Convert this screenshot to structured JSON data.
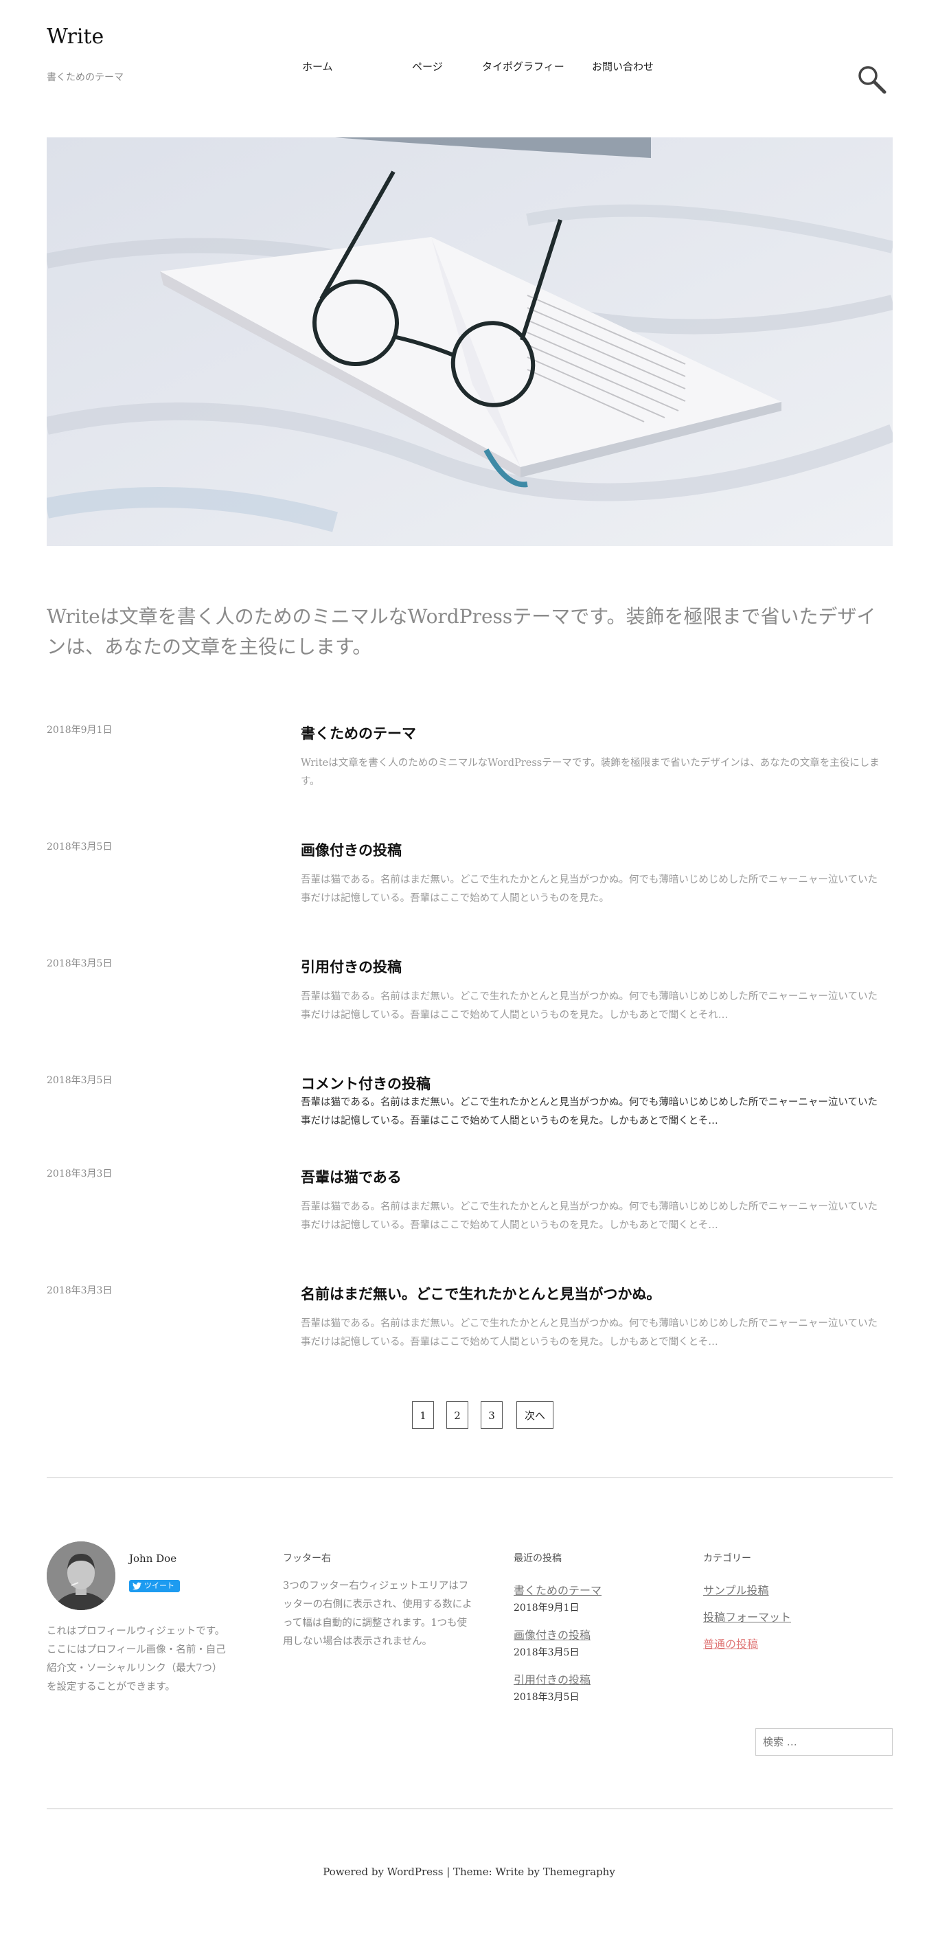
{
  "header": {
    "site_title": "Write",
    "site_description": "書くためのテーマ",
    "nav": [
      "ホーム",
      "ページ",
      "タイポグラフィー",
      "お問い合わせ"
    ]
  },
  "intro": "Writeは文章を書く人のためのミニマルなWordPressテーマです。装飾を極限まで省いたデザインは、あなたの文章を主役にします。",
  "posts": [
    {
      "date": "2018年9月1日",
      "title": "書くためのテーマ",
      "excerpt": "Writeは文章を書く人のためのミニマルなWordPressテーマです。装飾を極限まで省いたデザインは、あなたの文章を主役にします。"
    },
    {
      "date": "2018年3月5日",
      "title": "画像付きの投稿",
      "excerpt": "吾輩は猫である。名前はまだ無い。どこで生れたかとんと見当がつかぬ。何でも薄暗いじめじめした所でニャーニャー泣いていた事だけは記憶している。吾輩はここで始めて人間というものを見た。"
    },
    {
      "date": "2018年3月5日",
      "title": "引用付きの投稿",
      "excerpt": "吾輩は猫である。名前はまだ無い。どこで生れたかとんと見当がつかぬ。何でも薄暗いじめじめした所でニャーニャー泣いていた事だけは記憶している。吾輩はここで始めて人間というものを見た。しかもあとで聞くとそれ…"
    },
    {
      "date": "2018年3月5日",
      "title": "コメント付きの投稿",
      "excerpt": "吾輩は猫である。名前はまだ無い。どこで生れたかとんと見当がつかぬ。何でも薄暗いじめじめした所でニャーニャー泣いていた事だけは記憶している。吾輩はここで始めて人間というものを見た。しかもあとで聞くとそ…"
    },
    {
      "date": "2018年3月3日",
      "title": "吾輩は猫である",
      "excerpt": "吾輩は猫である。名前はまだ無い。どこで生れたかとんと見当がつかぬ。何でも薄暗いじめじめした所でニャーニャー泣いていた事だけは記憶している。吾輩はここで始めて人間というものを見た。しかもあとで聞くとそ…"
    },
    {
      "date": "2018年3月3日",
      "title": "名前はまだ無い。どこで生れたかとんと見当がつかぬ。",
      "excerpt": "吾輩は猫である。名前はまだ無い。どこで生れたかとんと見当がつかぬ。何でも薄暗いじめじめした所でニャーニャー泣いていた事だけは記憶している。吾輩はここで始めて人間というものを見た。しかもあとで聞くとそ…"
    }
  ],
  "pagination": [
    "1",
    "2",
    "3",
    "次へ"
  ],
  "footer": {
    "profile": {
      "name": "John Doe",
      "tweet_label": "ツイート",
      "text": "これはプロフィールウィジェットです。ここにはプロフィール画像・名前・自己紹介文・ソーシャルリンク（最大7つ）を設定することができます。"
    },
    "right": {
      "heading": "フッター右",
      "text": "3つのフッター右ウィジェットエリアはフッターの右側に表示され、使用する数によって幅は自動的に調整されます。1つも使用しない場合は表示されません。"
    },
    "recent": {
      "heading": "最近の投稿",
      "items": [
        {
          "title": "書くためのテーマ",
          "date": "2018年9月1日"
        },
        {
          "title": "画像付きの投稿",
          "date": "2018年3月5日"
        },
        {
          "title": "引用付きの投稿",
          "date": "2018年3月5日"
        }
      ]
    },
    "categories": {
      "heading": "カテゴリー",
      "items": [
        "サンプル投稿",
        "投稿フォーマット",
        "普通の投稿"
      ]
    },
    "search_placeholder": "検索 …",
    "credit_powered": "Powered by WordPress",
    "credit_sep": " | ",
    "credit_theme": "Theme: Write by Themegraphy"
  },
  "colors": {
    "accent_link": "#e07a7a",
    "muted_text": "#8a8a8a",
    "tweet_button": "#1d9bf0"
  },
  "icons": [
    "search-icon",
    "twitter-bird-icon"
  ]
}
